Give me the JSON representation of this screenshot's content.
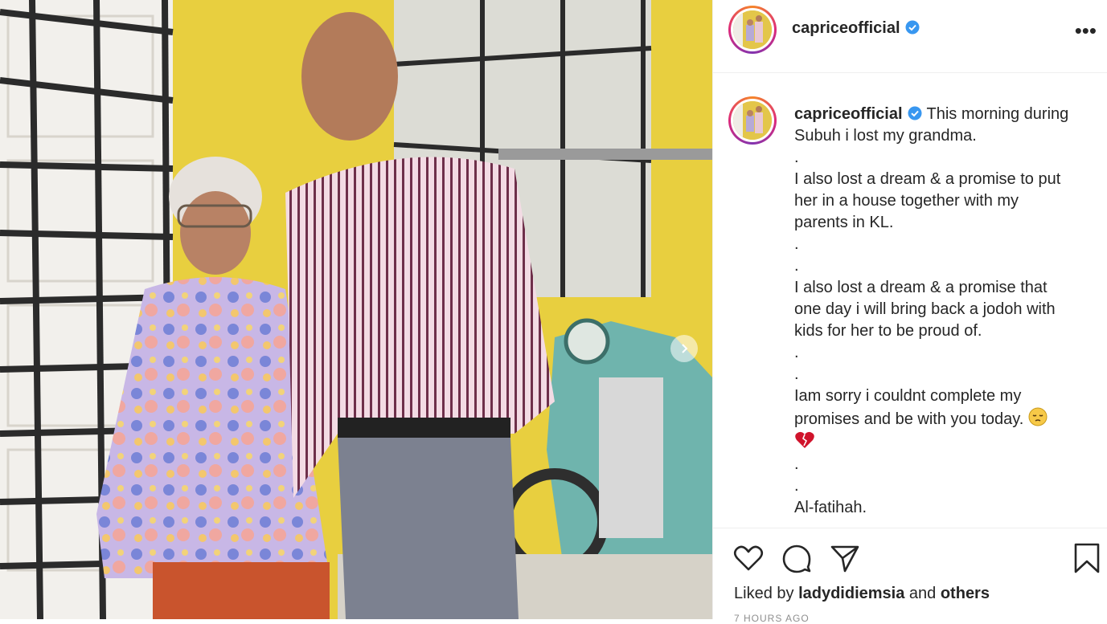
{
  "post": {
    "username": "capriceofficial",
    "more_label": "•••",
    "verified_icon": "verified-badge-icon",
    "accent_blue": "#3897f0"
  },
  "caption": {
    "username": "capriceofficial",
    "lines": [
      "This morning during",
      "Subuh i lost my grandma.",
      ".",
      "I also lost a dream & a promise to put",
      "her in a house together with my",
      "parents in KL.",
      ".",
      ".",
      "I also lost a dream & a promise that",
      "one day i will bring back a jodoh with",
      "kids for her to be proud of.",
      ".",
      ".",
      "Iam sorry i couldnt complete my",
      "promises and be with you today.",
      ".",
      ".",
      "Al-fatihah."
    ],
    "emoji_sad": "pensive-face-emoji",
    "emoji_heart": "broken-heart-emoji"
  },
  "actions": {
    "like_icon": "heart-icon",
    "comment_icon": "comment-icon",
    "share_icon": "paper-plane-icon",
    "save_icon": "bookmark-icon"
  },
  "likes": {
    "prefix": "Liked by",
    "user": "ladydidiemsia",
    "middle": "and",
    "others": "others"
  },
  "timestamp": "7 HOURS AGO",
  "carousel": {
    "next_icon": "chevron-right-icon"
  }
}
